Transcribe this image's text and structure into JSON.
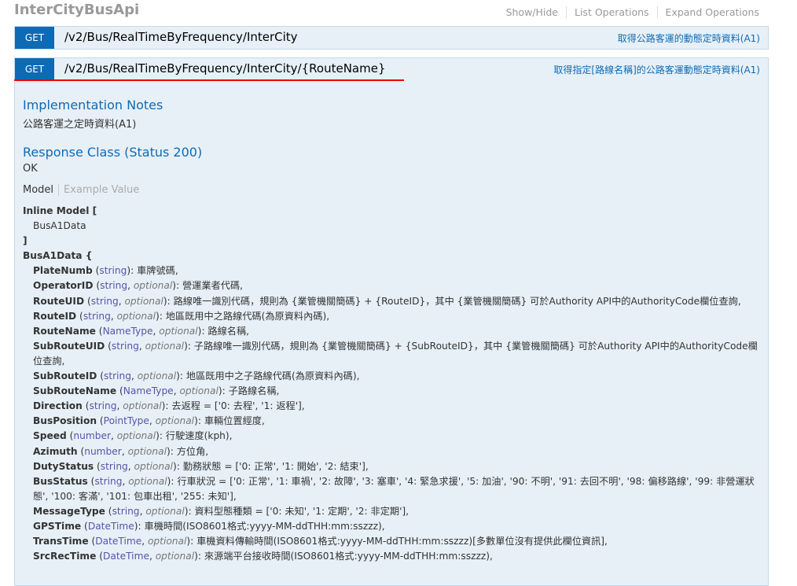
{
  "header": {
    "title": "InterCityBusApi",
    "links": [
      "Show/Hide",
      "List Operations",
      "Expand Operations"
    ]
  },
  "operations": [
    {
      "verb": "GET",
      "path": "/v2/Bus/RealTimeByFrequency/InterCity",
      "summary": "取得公路客運的動態定時資料(A1)"
    },
    {
      "verb": "GET",
      "path": "/v2/Bus/RealTimeByFrequency/InterCity/{RouteName}",
      "summary": "取得指定[路線名稱]的公路客運動態定時資料(A1)"
    }
  ],
  "details": {
    "impl_title": "Implementation Notes",
    "impl_text": "公路客運之定時資料(A1)",
    "resp_title": "Response Class (Status 200)",
    "resp_text": "OK",
    "tab_model": "Model",
    "tab_example": "Example Value",
    "inline_open": "Inline Model [",
    "inline_item": "BusA1Data",
    "inline_close": "]",
    "class_open": "BusA1Data {",
    "properties": [
      {
        "name": "PlateNumb",
        "type": "string",
        "opt": "",
        "desc": ": 車牌號碼,"
      },
      {
        "name": "OperatorID",
        "type": "string",
        "opt": "optional",
        "desc": ": 營運業者代碼,"
      },
      {
        "name": "RouteUID",
        "type": "string",
        "opt": "optional",
        "desc": ": 路線唯一識別代碼，規則為 {業管機關簡碼} + {RouteID}，其中 {業管機關簡碼} 可於Authority API中的AuthorityCode欄位查詢,"
      },
      {
        "name": "RouteID",
        "type": "string",
        "opt": "optional",
        "desc": ": 地區既用中之路線代碼(為原資料內碼),"
      },
      {
        "name": "RouteName",
        "type": "NameType",
        "opt": "optional",
        "desc": ": 路線名稱,"
      },
      {
        "name": "SubRouteUID",
        "type": "string",
        "opt": "optional",
        "desc": ": 子路線唯一識別代碼，規則為 {業管機關簡碼} + {SubRouteID}，其中 {業管機關簡碼} 可於Authority API中的AuthorityCode欄位查詢,"
      },
      {
        "name": "SubRouteID",
        "type": "string",
        "opt": "optional",
        "desc": ": 地區既用中之子路線代碼(為原資料內碼),"
      },
      {
        "name": "SubRouteName",
        "type": "NameType",
        "opt": "optional",
        "desc": ": 子路線名稱,"
      },
      {
        "name": "Direction",
        "type": "string",
        "opt": "optional",
        "desc": ": 去返程 = ['0: 去程', '1: 返程'],"
      },
      {
        "name": "BusPosition",
        "type": "PointType",
        "opt": "optional",
        "desc": ": 車輛位置經度,"
      },
      {
        "name": "Speed",
        "type": "number",
        "opt": "optional",
        "desc": ": 行駛速度(kph),"
      },
      {
        "name": "Azimuth",
        "type": "number",
        "opt": "optional",
        "desc": ": 方位角,"
      },
      {
        "name": "DutyStatus",
        "type": "string",
        "opt": "optional",
        "desc": ": 勤務狀態 = ['0: 正常', '1: 開始', '2: 結束'],"
      },
      {
        "name": "BusStatus",
        "type": "string",
        "opt": "optional",
        "desc": ": 行車狀況 = ['0: 正常', '1: 車禍', '2: 故障', '3: 塞車', '4: 緊急求援', '5: 加油', '90: 不明', '91: 去回不明', '98: 偏移路線', '99: 非營運狀態', '100: 客滿', '101: 包車出租', '255: 未知'],"
      },
      {
        "name": "MessageType",
        "type": "string",
        "opt": "optional",
        "desc": ": 資料型態種類 = ['0: 未知', '1: 定期', '2: 非定期'],"
      },
      {
        "name": "GPSTime",
        "type": "DateTime",
        "opt": "",
        "desc": ": 車機時間(ISO8601格式:yyyy-MM-ddTHH:mm:sszzz),"
      },
      {
        "name": "TransTime",
        "type": "DateTime",
        "opt": "optional",
        "desc": ": 車機資料傳輸時間(ISO8601格式:yyyy-MM-ddTHH:mm:sszzz)[多數單位沒有提供此欄位資訊],"
      },
      {
        "name": "SrcRecTime",
        "type": "DateTime",
        "opt": "optional",
        "desc": ": 來源端平台接收時間(ISO8601格式:yyyy-MM-ddTHH:mm:sszzz),"
      }
    ]
  }
}
